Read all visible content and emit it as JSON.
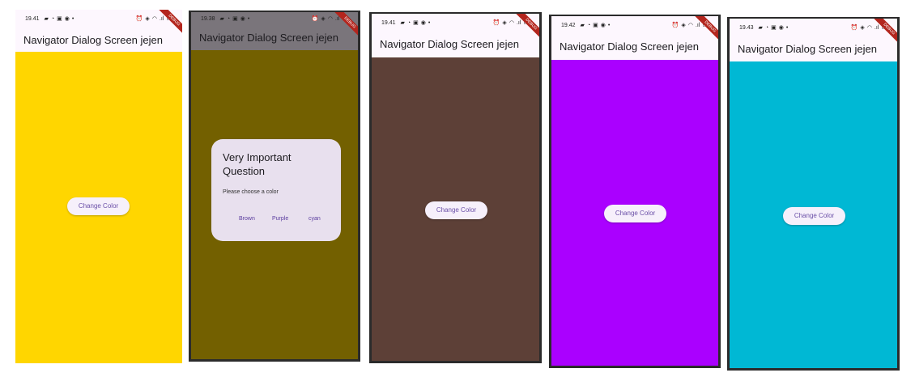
{
  "app_title": "Navigator Dialog Screen jejen",
  "button_label": "Change Color",
  "debug_banner": "DEBUG",
  "phones": [
    {
      "time": "19.41",
      "bg": "#ffd600"
    },
    {
      "time": "19.38",
      "bg": "#736000"
    },
    {
      "time": "19.41",
      "bg": "#5d4037"
    },
    {
      "time": "19.42",
      "bg": "#aa00ff"
    },
    {
      "time": "19.43",
      "bg": "#00b8d4"
    }
  ],
  "dialog": {
    "title": "Very Important Question",
    "message": "Please choose a color",
    "options": [
      "Brown",
      "Purple",
      "cyan"
    ]
  },
  "colors": {
    "appbar_bg": "#fdf7fe",
    "appbar_dim": "#7a757b",
    "button_bg": "#f6f0fb",
    "button_text": "#6a4fa7"
  }
}
